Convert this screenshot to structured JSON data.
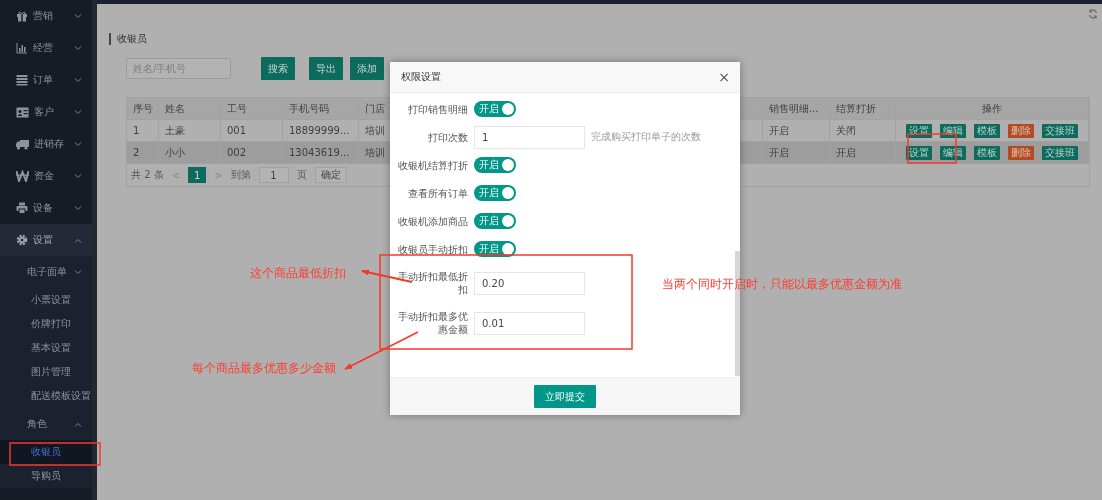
{
  "sidebar": {
    "items": [
      {
        "label": "营销",
        "expanded": false
      },
      {
        "label": "经营",
        "expanded": false
      },
      {
        "label": "订单",
        "expanded": false
      },
      {
        "label": "客户",
        "expanded": false
      },
      {
        "label": "进销存",
        "expanded": false
      },
      {
        "label": "资金",
        "expanded": false
      },
      {
        "label": "设备",
        "expanded": false
      },
      {
        "label": "设置",
        "expanded": true,
        "children": [
          {
            "label": "电子面单",
            "expanded": false
          },
          {
            "label": "小票设置",
            "selected": false
          },
          {
            "label": "价牌打印",
            "selected": false
          },
          {
            "label": "基本设置",
            "selected": false
          },
          {
            "label": "图片管理",
            "selected": false
          },
          {
            "label": "配送模板设置",
            "selected": false
          },
          {
            "label": "角色",
            "expanded": true,
            "children": [
              {
                "label": "收银员",
                "selected": true
              },
              {
                "label": "导购员",
                "selected": false
              }
            ]
          }
        ]
      }
    ]
  },
  "page_title": "收银员",
  "search": {
    "placeholder": "姓名/手机号"
  },
  "toolbar_buttons": [
    "搜索",
    "导出",
    "添加"
  ],
  "table": {
    "columns": [
      "序号",
      "姓名",
      "工号",
      "手机号码",
      "门店",
      "销售明细...",
      "结算打折",
      "操作"
    ],
    "rows": [
      {
        "selected": false,
        "cells": [
          "1",
          "土豪",
          "001",
          "18899999...",
          "培训",
          "开启",
          "关闭"
        ],
        "actions": [
          {
            "label": "设置",
            "kind": "primary"
          },
          {
            "label": "编辑",
            "kind": "primary"
          },
          {
            "label": "模板",
            "kind": "primary"
          },
          {
            "label": "删除",
            "kind": "danger"
          },
          {
            "label": "交接班",
            "kind": "primary"
          }
        ]
      },
      {
        "selected": true,
        "cells": [
          "2",
          "小小",
          "002",
          "13043619...",
          "培训",
          "开启",
          "开启"
        ],
        "actions": [
          {
            "label": "设置",
            "kind": "primary"
          },
          {
            "label": "编辑",
            "kind": "primary"
          },
          {
            "label": "模板",
            "kind": "primary"
          },
          {
            "label": "删除",
            "kind": "danger"
          },
          {
            "label": "交接班",
            "kind": "primary"
          }
        ]
      }
    ]
  },
  "pagination": {
    "total": "共 2 条",
    "prev": "<",
    "pages": [
      {
        "label": "1",
        "selected": true
      }
    ],
    "next": ">",
    "goto_label": "到第",
    "goto_value": "1",
    "page_unit": "页",
    "confirm": "确定"
  },
  "modal": {
    "title": "权限设置",
    "close": "×",
    "fields": [
      {
        "kind": "toggle",
        "label": "打印销售明细",
        "on": true,
        "text": "开启"
      },
      {
        "kind": "input",
        "label": "打印次数",
        "value": "1",
        "note": "完成购买打印单子的次数"
      },
      {
        "kind": "toggle",
        "label": "收银机结算打折",
        "on": true,
        "text": "开启"
      },
      {
        "kind": "toggle",
        "label": "查看所有订单",
        "on": true,
        "text": "开启"
      },
      {
        "kind": "toggle",
        "label": "收银机添加商品",
        "on": true,
        "text": "开启"
      },
      {
        "kind": "toggle",
        "label": "收银员手动折扣",
        "on": true,
        "text": "开启"
      },
      {
        "kind": "input",
        "label": "手动折扣最低折扣",
        "value": "0.20"
      },
      {
        "kind": "input",
        "label": "手动折扣最多优惠金额",
        "value": "0.01"
      }
    ],
    "submit": "立即提交"
  },
  "annotations": [
    "这个商品最低折扣",
    "每个商品最多优惠多少金额",
    "当两个同时开启时，只能以最多优惠金额为准"
  ]
}
